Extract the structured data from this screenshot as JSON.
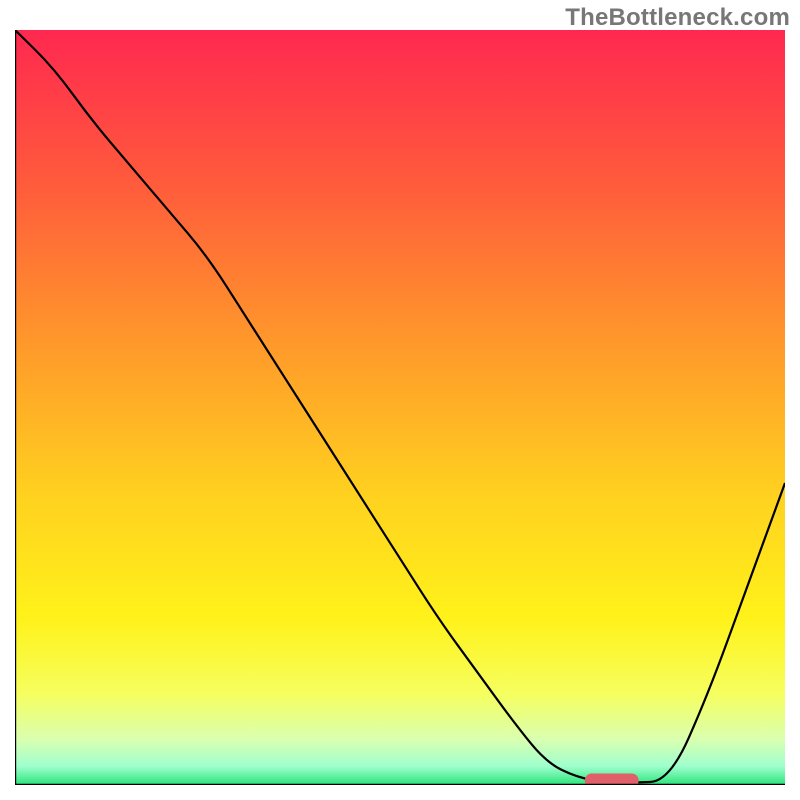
{
  "watermark": "TheBottleneck.com",
  "chart_data": {
    "type": "line",
    "title": "",
    "xlabel": "",
    "ylabel": "",
    "ylim": [
      0,
      100
    ],
    "xlim": [
      0,
      100
    ],
    "grid": false,
    "legend": false,
    "series": [
      {
        "name": "curve",
        "x": [
          0,
          5,
          10,
          15,
          20,
          25,
          30,
          35,
          40,
          45,
          50,
          55,
          60,
          65,
          69,
          73,
          77,
          80,
          85,
          90,
          95,
          100
        ],
        "values": [
          100,
          95,
          88,
          82,
          76,
          70,
          62,
          54,
          46,
          38,
          30,
          22,
          15,
          8,
          3,
          1,
          0.3,
          0.3,
          0.5,
          12,
          26,
          40
        ]
      }
    ],
    "marker": {
      "x_start": 74,
      "x_end": 81,
      "y": 0.6
    },
    "gradient_stops": [
      {
        "offset": 0.0,
        "color": "#ff2850"
      },
      {
        "offset": 0.2,
        "color": "#ff5a3c"
      },
      {
        "offset": 0.42,
        "color": "#ff9a2a"
      },
      {
        "offset": 0.62,
        "color": "#ffd21f"
      },
      {
        "offset": 0.78,
        "color": "#fff21a"
      },
      {
        "offset": 0.88,
        "color": "#f6ff60"
      },
      {
        "offset": 0.94,
        "color": "#d9ffb0"
      },
      {
        "offset": 0.975,
        "color": "#9fffce"
      },
      {
        "offset": 1.0,
        "color": "#2ae57a"
      }
    ],
    "axis_color": "#000000",
    "curve_color": "#000000",
    "marker_color": "#e0606a"
  }
}
